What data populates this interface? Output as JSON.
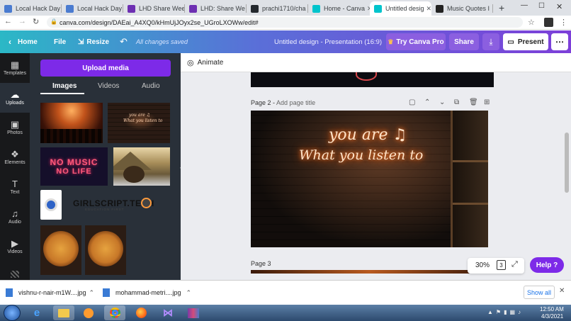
{
  "browser": {
    "tabs": [
      {
        "label": "Local Hack Day",
        "color": "#4a7bd0"
      },
      {
        "label": "Local Hack Day",
        "color": "#4a7bd0"
      },
      {
        "label": "LHD Share Wee",
        "color": "#6d2fb2"
      },
      {
        "label": "LHD: Share We",
        "color": "#6d2fb2"
      },
      {
        "label": "prachi1710/cha",
        "color": "#24292e"
      },
      {
        "label": "Home - Canva",
        "color": "#00c4cc"
      },
      {
        "label": "Untitled desig",
        "color": "#00c4cc"
      },
      {
        "label": "Music Quotes I",
        "color": "#222222"
      }
    ],
    "new_tab": "+",
    "url": "canva.com/design/DAEai_A4XQ0/kHmUjJOyx2se_UGroLXOWw/edit#"
  },
  "header": {
    "home": "Home",
    "file": "File",
    "resize": "Resize",
    "saved": "All changes saved",
    "title": "Untitled design - Presentation (16:9)",
    "try_pro": "Try Canva Pro",
    "share": "Share",
    "present": "Present"
  },
  "rail": [
    {
      "label": "Templates",
      "icon": "▦"
    },
    {
      "label": "Uploads",
      "icon": "☁"
    },
    {
      "label": "Photos",
      "icon": "▣"
    },
    {
      "label": "Elements",
      "icon": "❖"
    },
    {
      "label": "Text",
      "icon": "T"
    },
    {
      "label": "Audio",
      "icon": "♫"
    },
    {
      "label": "Videos",
      "icon": "▶"
    }
  ],
  "panel": {
    "upload_button": "Upload media",
    "tabs": [
      "Images",
      "Videos",
      "Audio"
    ],
    "neon_text": [
      "NO MUSIC",
      "NO LIFE"
    ],
    "logo_text": "GIRLSCRIPT.TECH",
    "logo_sub": "EDUCATION FIRST"
  },
  "canvas": {
    "animate": "Animate",
    "page2_label": "Page 2",
    "page2_title_placeholder": "Add page title",
    "page3_label": "Page 3",
    "slide_text_line1": "you are ♫",
    "slide_text_line2": "What you listen to",
    "zoom": "30%",
    "page_count": "3",
    "help": "Help ?"
  },
  "downloads": {
    "items": [
      "vishnu-r-nair-m1W....jpg",
      "mohammad-metri....jpg"
    ],
    "show_all": "Show all"
  },
  "taskbar": {
    "time": "12:50 AM",
    "date": "4/3/2021"
  }
}
